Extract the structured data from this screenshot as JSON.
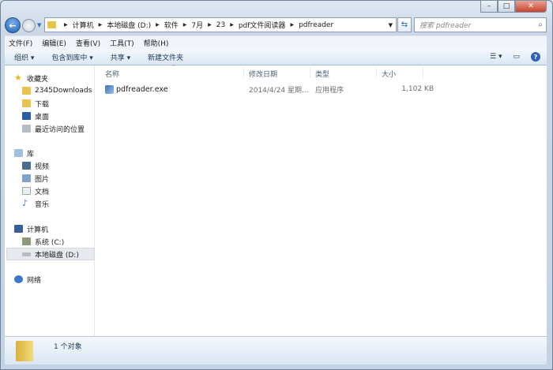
{
  "window": {
    "min": "–",
    "max": "□",
    "close": "✕"
  },
  "address": {
    "crumbs": [
      "计算机",
      "本地磁盘 (D:)",
      "软件",
      "7月",
      "23",
      "pdf文件阅读器",
      "pdfreader"
    ]
  },
  "search": {
    "placeholder": "搜索 pdfreader"
  },
  "menu": [
    "文件(F)",
    "编辑(E)",
    "查看(V)",
    "工具(T)",
    "帮助(H)"
  ],
  "toolbar": {
    "organize": "组织 ▾",
    "include": "包含到库中 ▾",
    "share": "共享 ▾",
    "new_folder": "新建文件夹",
    "help": "?"
  },
  "sidebar": {
    "favorites": {
      "label": "收藏夹",
      "items": [
        "2345Downloads",
        "下载",
        "桌面",
        "最近访问的位置"
      ]
    },
    "libraries": {
      "label": "库",
      "items": [
        "视频",
        "图片",
        "文档",
        "音乐"
      ]
    },
    "computer": {
      "label": "计算机",
      "items": [
        "系统 (C:)",
        "本地磁盘 (D:)"
      ]
    },
    "network": {
      "label": "网络"
    }
  },
  "columns": {
    "name": "名称",
    "date": "修改日期",
    "type": "类型",
    "size": "大小"
  },
  "files": [
    {
      "name": "pdfreader.exe",
      "date": "2014/4/24 星期...",
      "type": "应用程序",
      "size": "1,102 KB"
    }
  ],
  "status": {
    "count": "1 个对象"
  }
}
